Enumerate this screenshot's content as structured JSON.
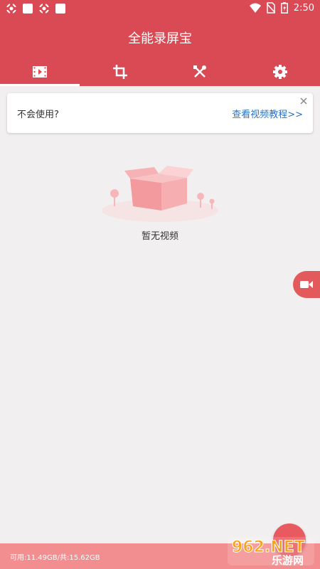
{
  "status_bar": {
    "time": "2:50"
  },
  "app": {
    "title": "全能录屏宝"
  },
  "tabs": [
    {
      "icon": "film-icon",
      "active": true
    },
    {
      "icon": "crop-icon",
      "active": false
    },
    {
      "icon": "tools-icon",
      "active": false
    },
    {
      "icon": "gear-icon",
      "active": false
    }
  ],
  "help_card": {
    "question": "不会使用?",
    "link": "查看视频教程>>"
  },
  "empty_state": {
    "message": "暂无视频"
  },
  "storage": {
    "text": "可用:11.49GB/共:15.62GB"
  },
  "watermark": {
    "brand_top": "962.NET",
    "brand_bottom": "乐游网"
  },
  "colors": {
    "primary": "#d94a54",
    "bottom_bar": "#f28d90",
    "link": "#2b72c4",
    "background": "#f2eff0"
  }
}
